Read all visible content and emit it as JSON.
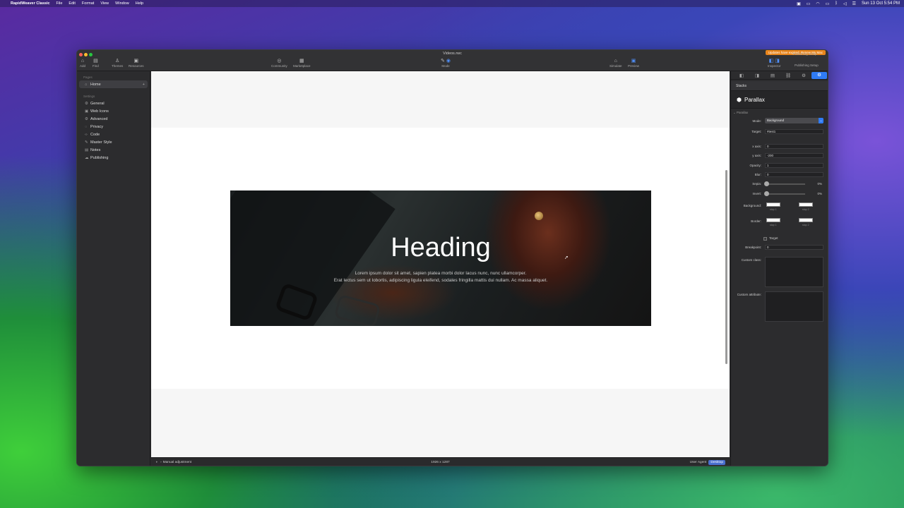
{
  "menubar": {
    "apple": "",
    "app": "RapidWeaver Classic",
    "items": [
      "File",
      "Edit",
      "Format",
      "View",
      "Window",
      "Help"
    ],
    "clock": "Sun 13 Oct  5:54 PM"
  },
  "window": {
    "title": "Videos.rwc",
    "expired": "Updates have expired. Renew My Mac"
  },
  "toolbar": {
    "add": "Add",
    "find": "Find",
    "themes": "Themes",
    "resources": "Resources",
    "community": "Community",
    "marketplace": "Marketplace",
    "mode": "Mode",
    "simulate": "Simulate",
    "preview": "Preview",
    "inspector": "Inspector",
    "publishing_setup": "Publishing Setup",
    "publishing_setup_top": "Publishing Setup"
  },
  "sidebar": {
    "pages_header": "Pages",
    "home": "Home",
    "settings_header": "Settings",
    "settings": [
      "General",
      "Web Icons",
      "Advanced",
      "Privacy",
      "Code",
      "Master Style",
      "Notes",
      "Publishing"
    ]
  },
  "canvas": {
    "heading": "Heading",
    "line1": "Lorem ipsum dolor sit amet, sapien platea morbi dolor lacus nunc, nunc ullamcorper.",
    "line2": "Erat lectus sem ut lobortis, adipiscing ligula eleifend, sodales fringilla mattis dui nullam. Ac massa aliquet."
  },
  "statusbar": {
    "manual": "Manual adjustment",
    "dims": "1926 x 1287",
    "ua_label": "User Agent",
    "ua_value": "Desktop"
  },
  "inspector": {
    "stacks": "Stacks",
    "title": "Parallax",
    "section": "Parallax",
    "mode_label": "Mode:",
    "mode_value": "Background",
    "target_label": "Target:",
    "target_value": "#test1",
    "xaxis_label": "x axis:",
    "xaxis_value": "0",
    "yaxis_label": "y axis:",
    "yaxis_value": "-200",
    "opacity_label": "Opacity:",
    "opacity_value": "1",
    "blur_label": "Blur:",
    "blur_value": "0",
    "sepia_label": "Sepia:",
    "sepia_value": "0%",
    "invert_label": "Invert:",
    "invert_value": "0%",
    "background_label": "Background:",
    "border_label": "Border:",
    "stop1": "stop 1",
    "stop2": "stop 2",
    "target_check": "Target",
    "breakpoint_label": "Breakpoint:",
    "breakpoint_value": "0",
    "custom_class": "Custom class:",
    "custom_attribute": "Custom attribute:"
  },
  "colors": {
    "accent": "#2f7bf5",
    "expired": "#e8851c"
  }
}
